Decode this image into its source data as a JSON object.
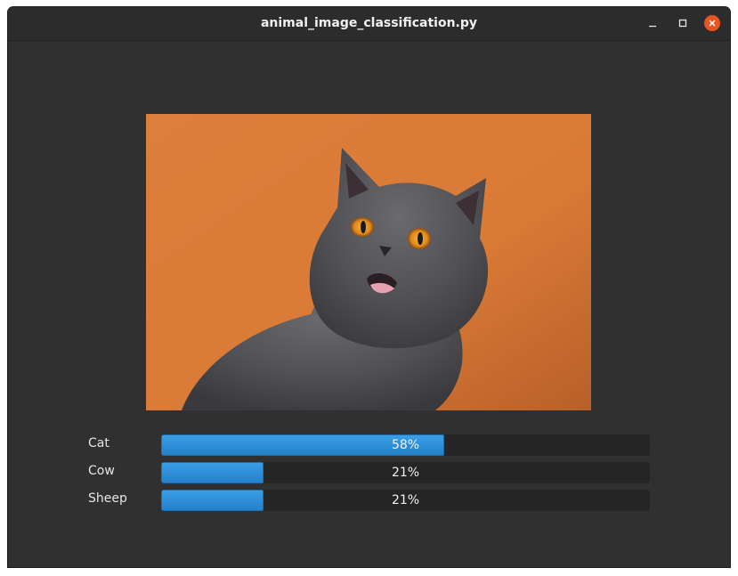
{
  "window": {
    "title": "animal_image_classification.py"
  },
  "image": {
    "subject": "cat",
    "background_color": "#d97a3a"
  },
  "predictions": [
    {
      "label": "Cat",
      "value": 0.58,
      "text": "58%"
    },
    {
      "label": "Cow",
      "value": 0.21,
      "text": "21%"
    },
    {
      "label": "Sheep",
      "value": 0.21,
      "text": "21%"
    }
  ],
  "colors": {
    "bar_fill": "#2e8fd9",
    "close_button": "#e95420"
  }
}
